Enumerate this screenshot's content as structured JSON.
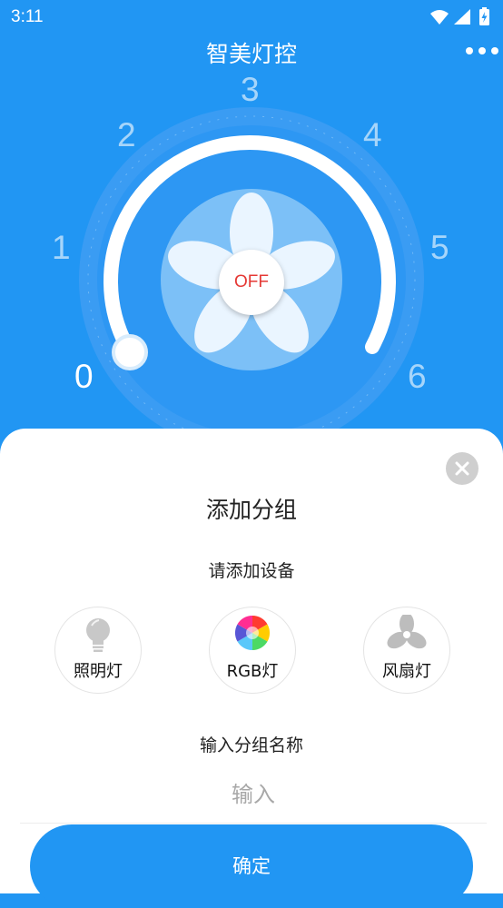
{
  "status_bar": {
    "time": "3:11",
    "icons": [
      "wifi-icon",
      "signal-icon",
      "battery-charging-icon"
    ]
  },
  "header": {
    "title": "智美灯控",
    "more_icon": "more-dots-icon"
  },
  "dial": {
    "labels": [
      "0",
      "1",
      "2",
      "3",
      "4",
      "5",
      "6"
    ],
    "level": 0,
    "power_label": "OFF",
    "fan_icon": "fan-icon"
  },
  "sheet": {
    "title": "添加分组",
    "prompt": "请添加设备",
    "close_icon": "close-icon",
    "devices": [
      {
        "label": "照明灯",
        "icon": "bulb-icon"
      },
      {
        "label": "RGB灯",
        "icon": "color-wheel-icon"
      },
      {
        "label": "风扇灯",
        "icon": "fan-icon"
      }
    ],
    "name_label": "输入分组名称",
    "name_placeholder": "输入",
    "name_value": "",
    "confirm_label": "确定"
  },
  "colors": {
    "primary": "#2196F3",
    "off_text": "#e53935",
    "sheet_bg": "#ffffff"
  }
}
